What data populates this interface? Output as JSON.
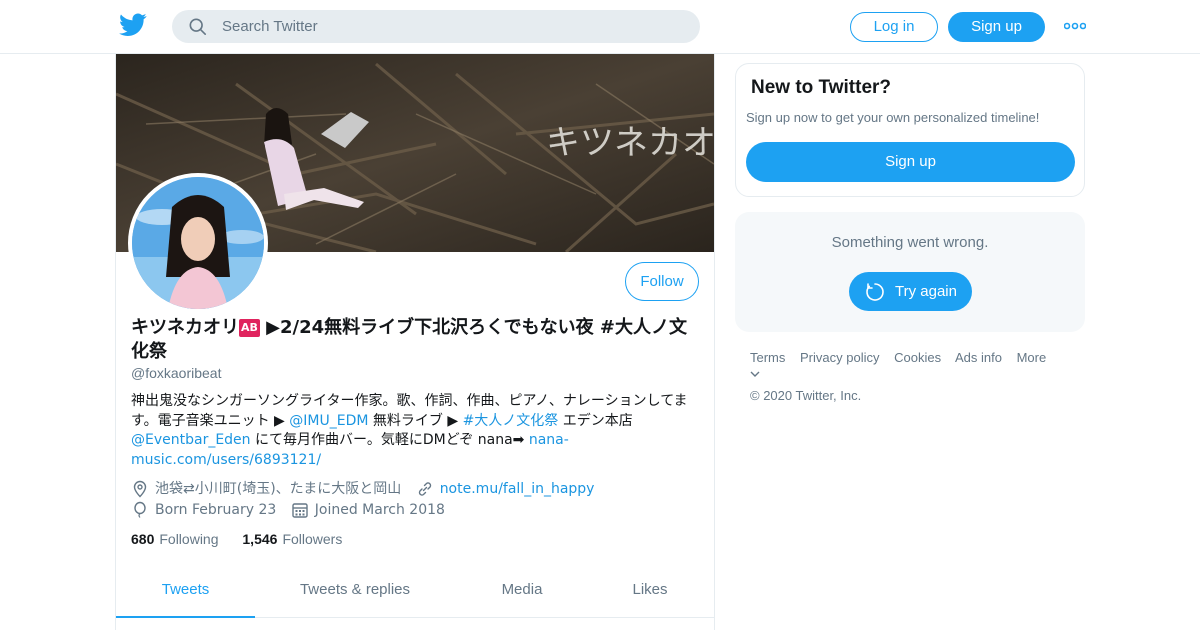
{
  "header": {
    "logo_icon": "twitter-bird-icon",
    "search_placeholder": "Search Twitter",
    "login_label": "Log in",
    "signup_label": "Sign up",
    "more_icon": "more-dots-icon",
    "accent": "#1da1f2"
  },
  "profile": {
    "name_main": "キツネカオリ",
    "name_badge": "🆎",
    "name_rest": " ▶2/24無料ライブ下北沢ろくでもない夜 #大人ノ文化祭",
    "handle": "@foxkaoribeat",
    "follow_label": "Follow",
    "bio": {
      "t1": "神出鬼没なシンガーソングライター作家。歌、作詞、作曲、ピアノ、ナレーションしてます。電子音楽ユニット ▶ ",
      "l1": "@IMU_EDM",
      "t2": " 無料ライブ ▶ ",
      "l2": "#大人ノ文化祭",
      "t3": " エデン本店 ",
      "l3": "@Eventbar_Eden",
      "t4": " にて毎月作曲バー。気軽にDMどぞ nana➡ ",
      "l4": "nana-music.com/users/6893121/"
    },
    "location": "池袋⇄小川町(埼玉)、たまに大阪と岡山",
    "website": "note.mu/fall_in_happy",
    "born": "Born February 23",
    "joined": "Joined March 2018",
    "following_count": "680",
    "following_label": "Following",
    "followers_count": "1,546",
    "followers_label": "Followers",
    "banner_text": "キツネカオリ"
  },
  "tabs": [
    {
      "label": "Tweets",
      "active": true
    },
    {
      "label": "Tweets & replies",
      "active": false
    },
    {
      "label": "Media",
      "active": false
    },
    {
      "label": "Likes",
      "active": false
    }
  ],
  "sidebar": {
    "new_title": "New to Twitter?",
    "new_desc": "Sign up now to get your own personalized timeline!",
    "new_signup_label": "Sign up",
    "error_text": "Something went wrong.",
    "retry_label": "Try again"
  },
  "footer": {
    "links": [
      "Terms",
      "Privacy policy",
      "Cookies",
      "Ads info",
      "More"
    ],
    "copyright": "© 2020 Twitter, Inc."
  }
}
